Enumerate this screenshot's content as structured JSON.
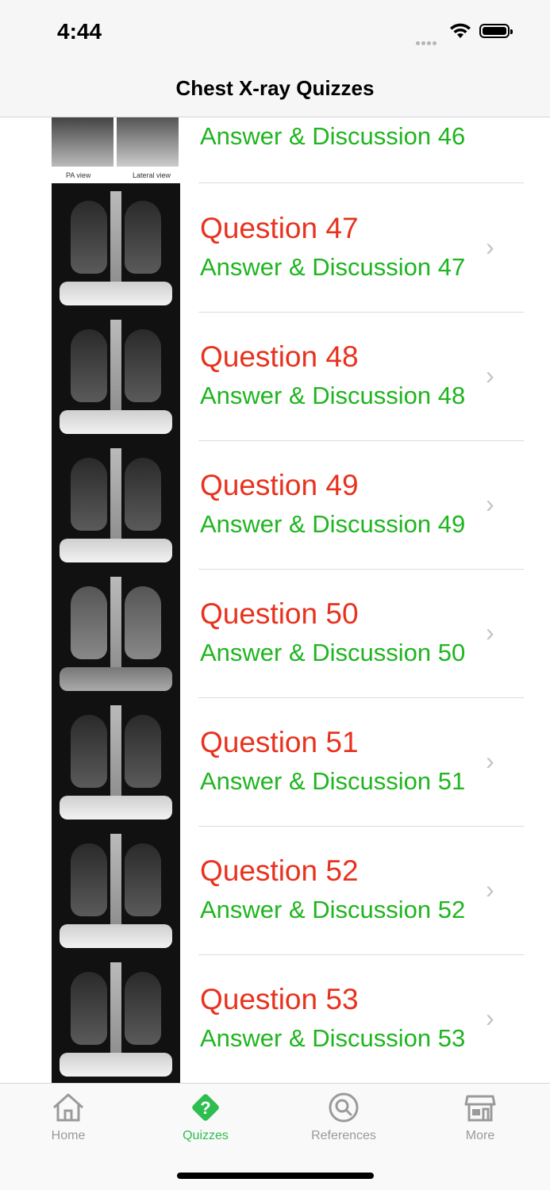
{
  "status": {
    "time": "4:44"
  },
  "nav": {
    "title": "Chest X-ray Quizzes"
  },
  "first_partial": {
    "answer": "Answer & Discussion 46",
    "thumb_caption_left": "PA view",
    "thumb_caption_right": "Lateral view"
  },
  "rows": [
    {
      "question": "Question 47",
      "answer": "Answer & Discussion 47"
    },
    {
      "question": "Question 48",
      "answer": "Answer & Discussion 48"
    },
    {
      "question": "Question 49",
      "answer": "Answer & Discussion 49"
    },
    {
      "question": "Question 50",
      "answer": "Answer & Discussion 50"
    },
    {
      "question": "Question 51",
      "answer": "Answer & Discussion 51"
    },
    {
      "question": "Question 52",
      "answer": "Answer & Discussion 52"
    },
    {
      "question": "Question 53",
      "answer": "Answer & Discussion 53"
    }
  ],
  "tabs": [
    {
      "label": "Home",
      "icon": "house-icon",
      "active": false
    },
    {
      "label": "Quizzes",
      "icon": "question-diamond-icon",
      "active": true
    },
    {
      "label": "References",
      "icon": "search-icon",
      "active": false
    },
    {
      "label": "More",
      "icon": "store-icon",
      "active": false
    }
  ],
  "colors": {
    "question": "#e8321e",
    "answer": "#1fb51f",
    "active_tab": "#2ebd4f"
  }
}
